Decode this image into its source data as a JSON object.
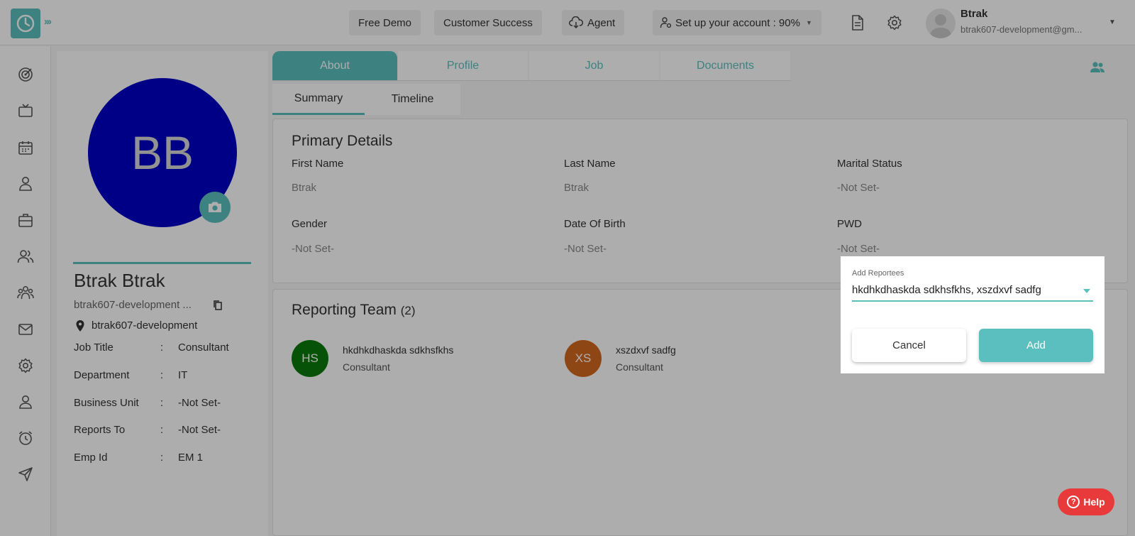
{
  "topbar": {
    "free_demo": "Free Demo",
    "customer_success": "Customer Success",
    "agent": "Agent",
    "setup_account": "Set up your account : 90%",
    "user_name": "Btrak",
    "user_email": "btrak607-development@gm..."
  },
  "tabs": [
    "About",
    "Profile",
    "Job",
    "Documents"
  ],
  "subtabs": [
    "Summary",
    "Timeline"
  ],
  "profile": {
    "initials": "BB",
    "avatar_color": "#0000c8",
    "name": "Btrak Btrak",
    "email": "btrak607-development ...",
    "location": "btrak607-development",
    "fields": [
      {
        "label": "Job Title",
        "value": "Consultant"
      },
      {
        "label": "Department",
        "value": "IT"
      },
      {
        "label": "Business Unit",
        "value": "-Not Set-"
      },
      {
        "label": "Reports To",
        "value": "-Not Set-"
      },
      {
        "label": "Emp Id",
        "value": "EM 1"
      }
    ]
  },
  "primary_details": {
    "title": "Primary Details",
    "fields": [
      {
        "label": "First Name",
        "value": "Btrak"
      },
      {
        "label": "Last Name",
        "value": "Btrak"
      },
      {
        "label": "Marital Status",
        "value": "-Not Set-"
      },
      {
        "label": "Gender",
        "value": "-Not Set-"
      },
      {
        "label": "Date Of Birth",
        "value": "-Not Set-"
      },
      {
        "label": "PWD",
        "value": "-Not Set-"
      }
    ]
  },
  "reporting_team": {
    "title": "Reporting Team",
    "count": "(2)",
    "members": [
      {
        "initials": "HS",
        "name": "hkdhkdhaskda sdkhsfkhs",
        "role": "Consultant",
        "color": "#0a7a0a"
      },
      {
        "initials": "XS",
        "name": "xszdxvf sadfg",
        "role": "Consultant",
        "color": "#d2691e"
      }
    ]
  },
  "dialog": {
    "label": "Add Reportees",
    "selected": "hkdhkdhaskda sdkhsfkhs, xszdxvf sadfg",
    "cancel": "Cancel",
    "add": "Add"
  },
  "help": {
    "label": "Help",
    "icon": "?"
  },
  "colors": {
    "accent": "#5cbfbf",
    "help": "#e83a3a"
  }
}
